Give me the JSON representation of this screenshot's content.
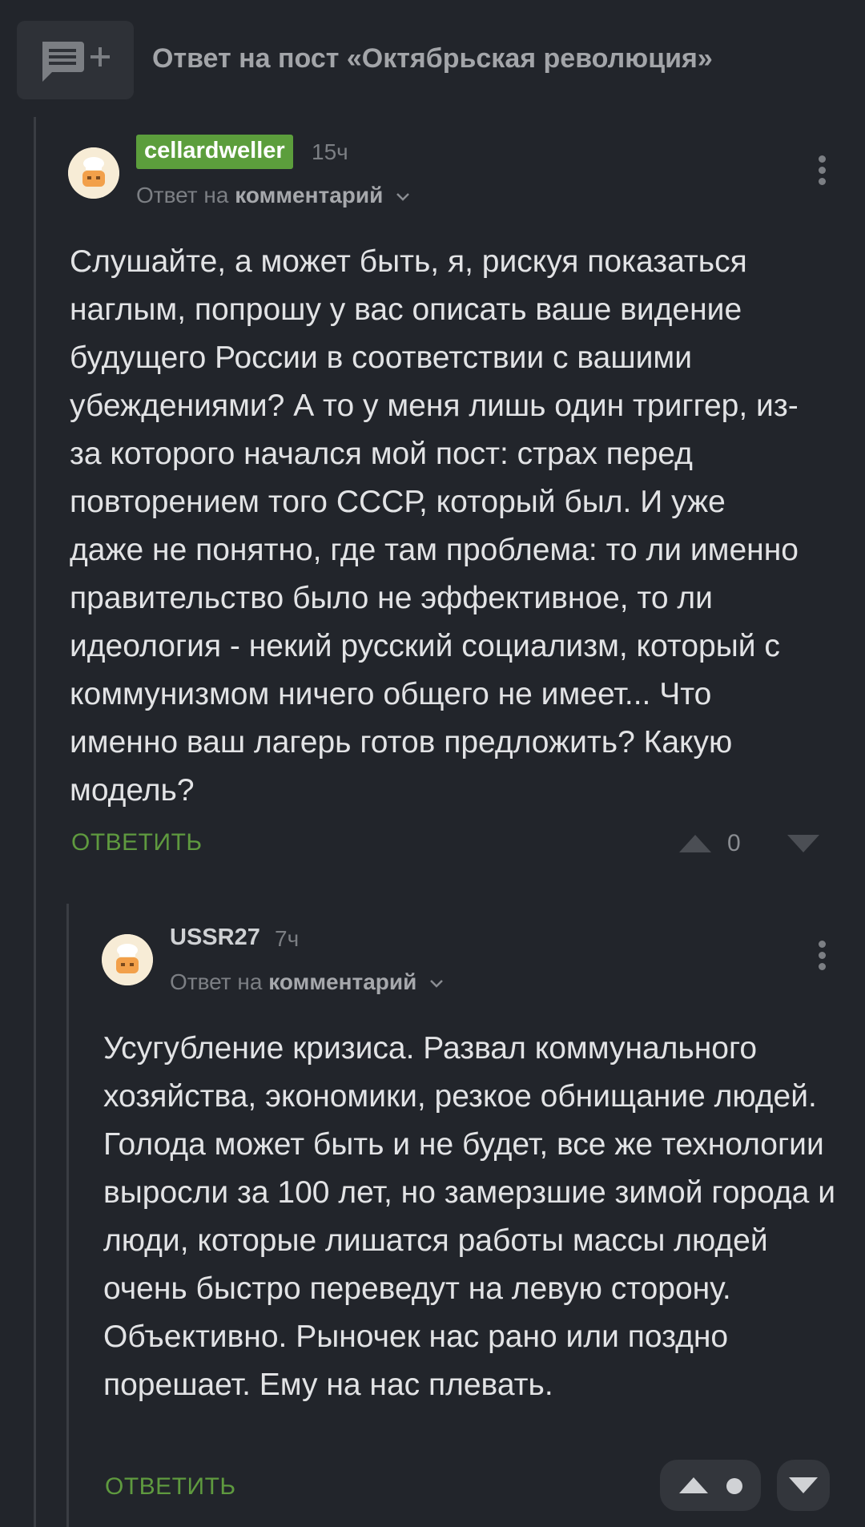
{
  "header": {
    "title": "Ответ на пост «Октябрьская революция»",
    "reply_icon": "comment-add-icon"
  },
  "comments": [
    {
      "username": "cellardweller",
      "time": "15ч",
      "reply_prefix": "Ответ на",
      "reply_target": "комментарий",
      "text": "Слушайте, а может быть, я, рискуя показаться наглым, попрошу у вас описать ваше видение будущего России в соответствии с вашими убеждениями? А то у меня лишь один триггер, из-за которого начался мой пост: страх перед повторением того СССР, который был. И уже даже не понятно, где там проблема: то ли именно правительство было не эффективное, то ли идеология - некий русский социализм, который с коммунизмом ничего общего не имеет... Что именно ваш лагерь готов предложить? Какую модель?",
      "answer_label": "ОТВЕТИТЬ",
      "rating": "0"
    },
    {
      "username": "USSR27",
      "time": "7ч",
      "reply_prefix": "Ответ на",
      "reply_target": "комментарий",
      "text": "Усугубление кризиса. Развал коммунального хозяйства, экономики, резкое обнищание людей. Голода может быть и не будет, все же технологии выросли за 100 лет, но замерзшие зимой города и люди, которые лишатся работы массы людей очень быстро переведут на левую сторону. Объективно. Рыночек нас рано или поздно порешает. Ему на нас плевать.",
      "answer_label": "ОТВЕТИТЬ"
    }
  ],
  "colors": {
    "background": "#22252b",
    "username_badge": "#5c9e3c",
    "answer_link": "#5f9a3f"
  }
}
